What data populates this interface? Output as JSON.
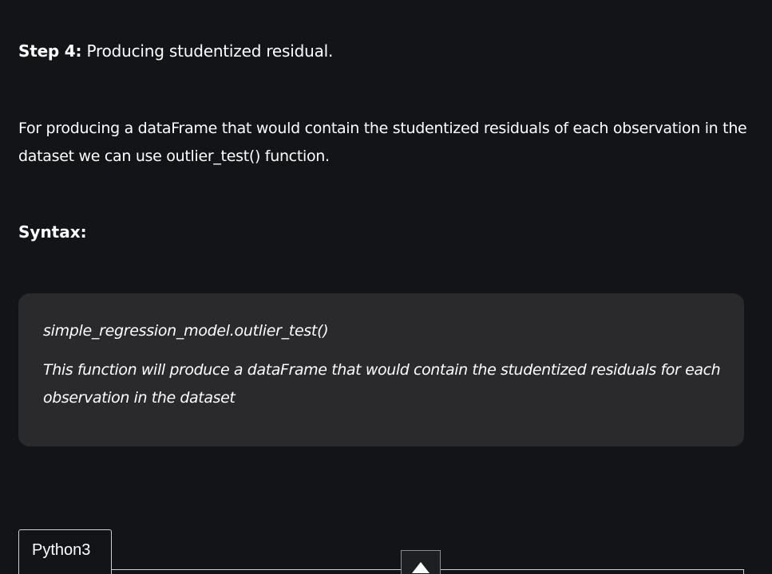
{
  "step": {
    "label": "Step 4:",
    "text": "Producing studentized residual."
  },
  "paragraph": "For producing a dataFrame that would contain the studentized residuals of each observation in the dataset we can use outlier_test() function.",
  "syntax_title": "Syntax:",
  "syntax_box": {
    "code": "simple_regression_model.outlier_test()",
    "description": "This function will produce a dataFrame that would contain the studentized residuals for each observation in the dataset"
  },
  "code_tab": {
    "language": "Python3"
  },
  "scroll_button": {
    "icon": "chevron-up-icon"
  },
  "colors": {
    "background": "#131417",
    "box_background": "#2a2a2d",
    "text": "#ffffff"
  }
}
